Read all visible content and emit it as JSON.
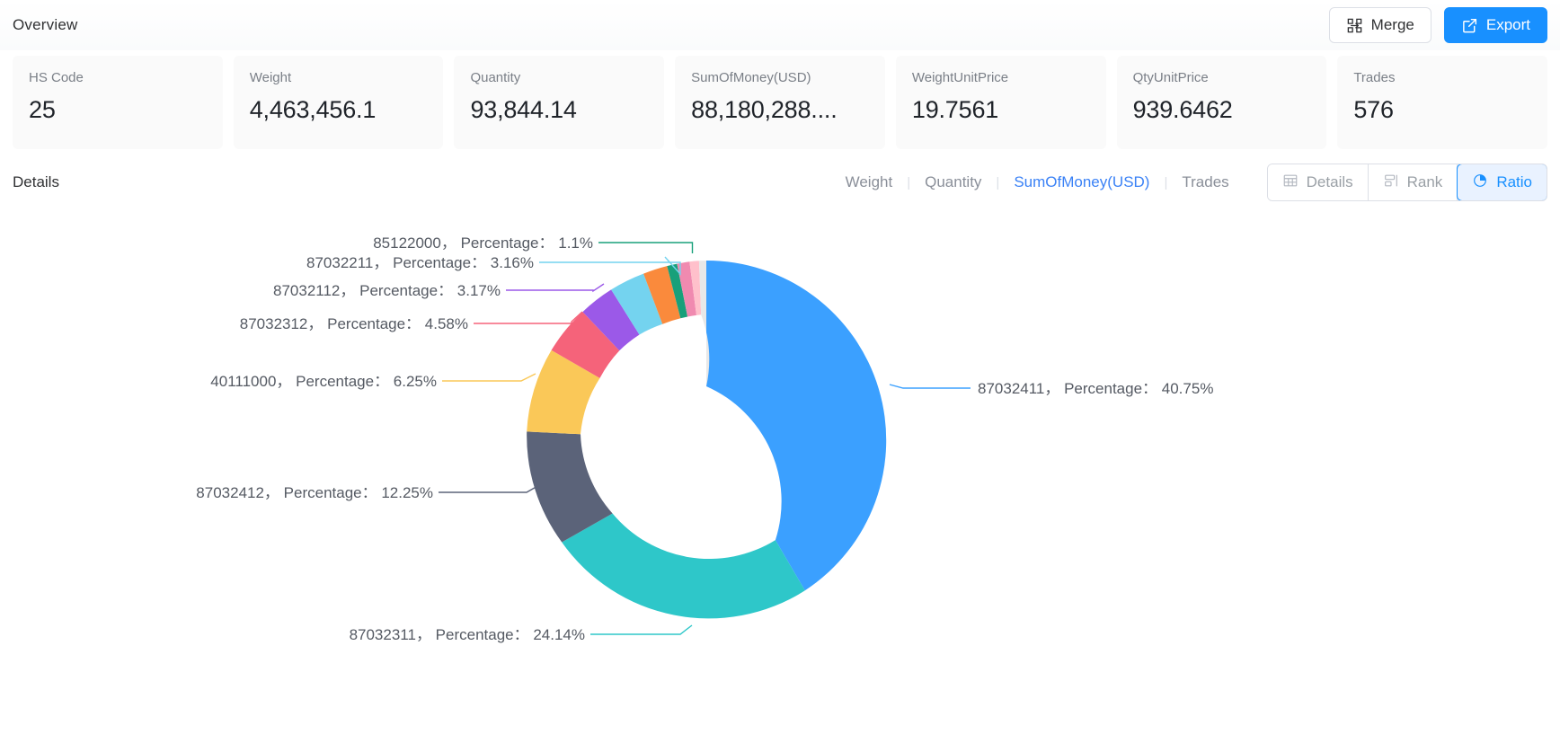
{
  "header": {
    "title": "Overview",
    "merge_label": "Merge",
    "export_label": "Export",
    "merge_icon": "merge-icon",
    "export_icon": "external-link-icon"
  },
  "stats": [
    {
      "label": "HS Code",
      "value": "25"
    },
    {
      "label": "Weight",
      "value": "4,463,456.1"
    },
    {
      "label": "Quantity",
      "value": "93,844.14"
    },
    {
      "label": "SumOfMoney(USD)",
      "value": "88,180,288...."
    },
    {
      "label": "WeightUnitPrice",
      "value": "19.7561"
    },
    {
      "label": "QtyUnitPrice",
      "value": "939.6462"
    },
    {
      "label": "Trades",
      "value": "576"
    }
  ],
  "details": {
    "title": "Details",
    "separator": "|",
    "metric_tabs": [
      {
        "label": "Weight",
        "active": false
      },
      {
        "label": "Quantity",
        "active": false
      },
      {
        "label": "SumOfMoney(USD)",
        "active": true
      },
      {
        "label": "Trades",
        "active": false
      }
    ],
    "view_buttons": [
      {
        "label": "Details",
        "icon": "table-icon",
        "active": false
      },
      {
        "label": "Rank",
        "icon": "bar-rank-icon",
        "active": false
      },
      {
        "label": "Ratio",
        "icon": "pie-chart-icon",
        "active": true
      }
    ]
  },
  "chart_data": {
    "type": "pie",
    "variant": "donut",
    "title": "",
    "value_label": "Percentage",
    "label_separator": "，",
    "label_colon": "：",
    "legend": "none",
    "labels": [
      "87032411",
      "87032311",
      "87032412",
      "40111000",
      "87032312",
      "87032112",
      "87032211",
      "85122000"
    ],
    "values": [
      40.75,
      24.14,
      12.25,
      6.25,
      4.58,
      3.17,
      3.16,
      1.1
    ],
    "unit": "%",
    "colors": [
      "#3ba0ff",
      "#2ec7c9",
      "#5b6379",
      "#fac858",
      "#f5637a",
      "#9b59e8",
      "#74d3ef",
      "#fa8a3c"
    ],
    "extra_slices": [
      {
        "label": "",
        "value": 0.9,
        "color": "#18a07a"
      },
      {
        "label": "",
        "value": 0.85,
        "color": "#f08ab0"
      },
      {
        "label": "",
        "value": 0.75,
        "color": "#e8e8e8"
      },
      {
        "label": "",
        "value": 2.1,
        "color": "#ffc0cb"
      }
    ],
    "display_labels": [
      {
        "text": "85122000，  Percentage：  1.1%",
        "color": "#18a07a"
      },
      {
        "text": "87032211，  Percentage：  3.16%",
        "color": "#74d3ef"
      },
      {
        "text": "87032112，  Percentage：  3.17%",
        "color": "#9b59e8"
      },
      {
        "text": "87032312，  Percentage：  4.58%",
        "color": "#f5637a"
      },
      {
        "text": "40111000，  Percentage：  6.25%",
        "color": "#fac858"
      },
      {
        "text": "87032412，  Percentage：  12.25%",
        "color": "#5b6379"
      },
      {
        "text": "87032311，  Percentage：  24.14%",
        "color": "#2ec7c9"
      },
      {
        "text": "87032411，  Percentage：  40.75%",
        "color": "#3ba0ff"
      }
    ]
  },
  "theme": {
    "primary": "#1890ff",
    "accent_text": "#3b82f6",
    "card_bg": "#fafafa",
    "muted_text": "#8a8f99"
  }
}
